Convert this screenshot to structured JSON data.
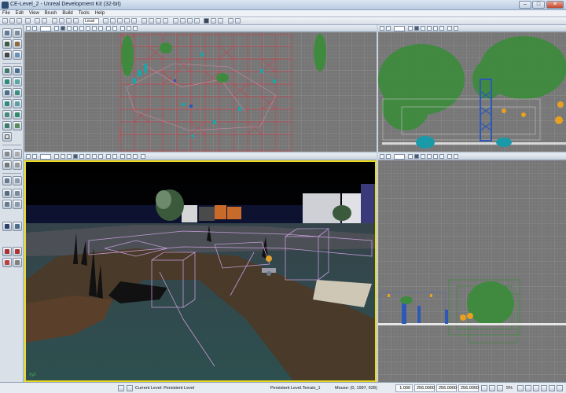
{
  "window": {
    "title": "CE-Level_2 - Unreal Development Kit (32-bit)",
    "minimize_label": "–",
    "maximize_label": "□",
    "close_label": "✕"
  },
  "menu": [
    "File",
    "Edit",
    "View",
    "Brush",
    "Build",
    "Tools",
    "Help"
  ],
  "toolbar": {
    "grid_combo_value": "Local"
  },
  "status": {
    "current_level": "Current Level:  Persistent Level",
    "level_detail": "Persistent Level.Terrain_1",
    "mouse": "Mouse: (0, 1997, 628)",
    "drag_grid": "1.000",
    "x": "256.0000",
    "y": "256.0000",
    "z": "256.0000",
    "rotation": "5%"
  },
  "viewports": {
    "top": {
      "name": "Top"
    },
    "side": {
      "name": "Side"
    },
    "perspective": {
      "name": "Perspective"
    },
    "front": {
      "name": "Front"
    }
  },
  "colors": {
    "viewport_active_border": "#e8d820",
    "grid_bg": "#767676",
    "wire_red": "#c0444c",
    "foliage_green": "#3f8a3f",
    "actor_cyan": "#1aa6a6",
    "actor_blue": "#2e58b8"
  }
}
